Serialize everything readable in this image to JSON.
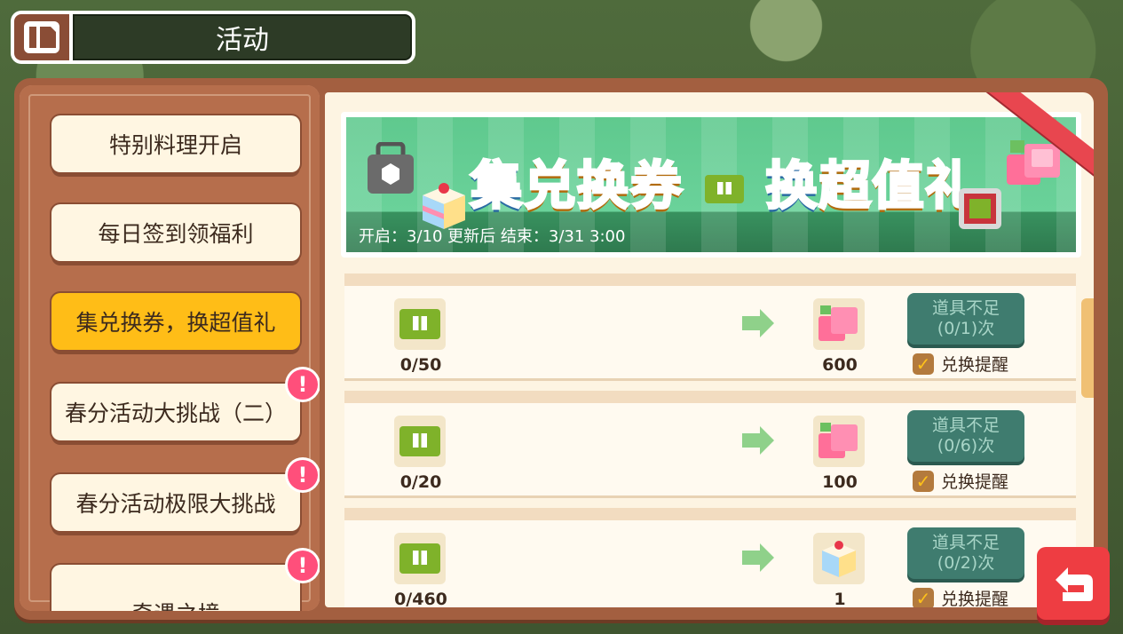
{
  "header": {
    "title": "活动",
    "menu_icon": "book-icon"
  },
  "sidebar": {
    "items": [
      {
        "label": "特别料理开启",
        "active": false,
        "alert": false
      },
      {
        "label": "每日签到领福利",
        "active": false,
        "alert": false
      },
      {
        "label": "集兑换券，换超值礼",
        "active": true,
        "alert": false
      },
      {
        "label": "春分活动大挑战（二）",
        "active": false,
        "alert": true
      },
      {
        "label": "春分活动极限大挑战",
        "active": false,
        "alert": true
      },
      {
        "label": "奇遇之境",
        "active": false,
        "alert": true
      }
    ],
    "alert_glyph": "!"
  },
  "banner": {
    "title_part1": "集",
    "title_part2": "兑换券",
    "title_part3": "换",
    "title_part4": "超值礼",
    "date_text": "开启：3/10 更新后 结束：3/31 3:00",
    "ribbon_color": "#e8464f"
  },
  "rows": [
    {
      "cost": "0/50",
      "reward": "600",
      "reward_icon": "pink-cube-icon",
      "button_line1": "道具不足",
      "button_line2": "(0/1)次",
      "remind_label": "兑换提醒",
      "remind_checked": true
    },
    {
      "cost": "0/20",
      "reward": "100",
      "reward_icon": "pink-cube-icon",
      "button_line1": "道具不足",
      "button_line2": "(0/6)次",
      "remind_label": "兑换提醒",
      "remind_checked": true
    },
    {
      "cost": "0/460",
      "reward": "1",
      "reward_icon": "rainbow-cake-icon",
      "button_line1": "道具不足",
      "button_line2": "(0/2)次",
      "remind_label": "兑换提醒",
      "remind_checked": true
    }
  ],
  "colors": {
    "active_tab": "#ffbd17",
    "insufficient_button": "#3f7c6f",
    "back_button": "#ee3d42"
  },
  "back_button_icon": "return-arrow-icon"
}
